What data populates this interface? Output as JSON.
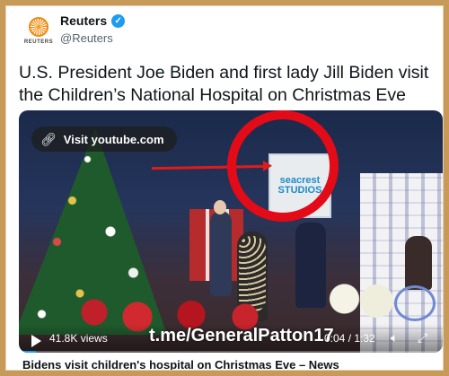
{
  "account": {
    "logo_text": "REUTERS",
    "name": "Reuters",
    "handle": "@Reuters",
    "verified": true
  },
  "tweet": {
    "headline": "U.S. President Joe Biden and first lady Jill Biden visit the Children’s National Hospital on Christmas Eve"
  },
  "video": {
    "link_label": "Visit youtube.com",
    "sign_text_line1": "seacrest",
    "sign_text_line2": "STUDIOS",
    "views": "41.8K views",
    "watermark": "t.me/GeneralPatton17",
    "time": "0:04 / 1:32",
    "progress_fraction": 0.04
  },
  "card": {
    "source_title": "Bidens visit children's hospital on Christmas Eve – News"
  },
  "colors": {
    "background": "#c79a5a",
    "verified_badge": "#1d9bf0",
    "annotation_red": "#e30b17",
    "sign_blue": "#1e8cc8"
  }
}
